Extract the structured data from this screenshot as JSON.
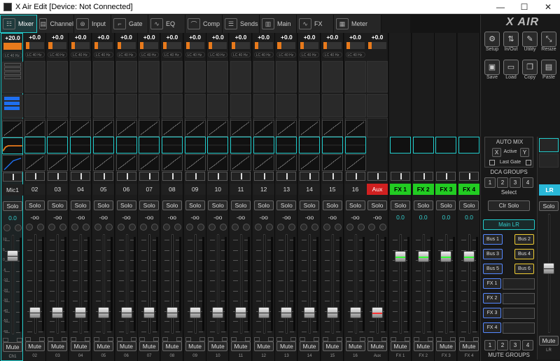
{
  "window": {
    "title": "X Air Edit [Device: Not Connected]",
    "min": "—",
    "max": "☐",
    "close": "✕"
  },
  "tabs": [
    {
      "label": "Mixer",
      "icon": "mixer-icon",
      "sym": "☷"
    },
    {
      "label": "Channel",
      "icon": "channel-icon",
      "sym": "▤"
    },
    {
      "label": "Input",
      "icon": "input-icon",
      "sym": "⊛"
    },
    {
      "label": "Gate",
      "icon": "gate-icon",
      "sym": "⌐"
    },
    {
      "label": "EQ",
      "icon": "eq-icon",
      "sym": "∿"
    },
    {
      "label": "Comp",
      "icon": "comp-icon",
      "sym": "⌒"
    },
    {
      "label": "Sends",
      "icon": "sends-icon",
      "sym": "☰"
    },
    {
      "label": "Main",
      "icon": "main-icon",
      "sym": "▥"
    },
    {
      "label": "FX",
      "icon": "fx-icon",
      "sym": "∿"
    },
    {
      "label": "Meter",
      "icon": "meter-icon",
      "sym": "▦"
    }
  ],
  "channels": [
    {
      "gain": "+20.0",
      "name": "Mic1",
      "pan": "0.0",
      "foot": "Ch1",
      "type": "mic"
    },
    {
      "gain": "+0.0",
      "name": "02",
      "pan": "-oo",
      "foot": "02",
      "type": "ch"
    },
    {
      "gain": "+0.0",
      "name": "03",
      "pan": "-oo",
      "foot": "03",
      "type": "ch"
    },
    {
      "gain": "+0.0",
      "name": "04",
      "pan": "-oo",
      "foot": "04",
      "type": "ch"
    },
    {
      "gain": "+0.0",
      "name": "05",
      "pan": "-oo",
      "foot": "05",
      "type": "ch"
    },
    {
      "gain": "+0.0",
      "name": "06",
      "pan": "-oo",
      "foot": "06",
      "type": "ch"
    },
    {
      "gain": "+0.0",
      "name": "07",
      "pan": "-oo",
      "foot": "07",
      "type": "ch"
    },
    {
      "gain": "+0.0",
      "name": "08",
      "pan": "-oo",
      "foot": "08",
      "type": "ch"
    },
    {
      "gain": "+0.0",
      "name": "09",
      "pan": "-oo",
      "foot": "09",
      "type": "ch"
    },
    {
      "gain": "+0.0",
      "name": "10",
      "pan": "-oo",
      "foot": "10",
      "type": "ch"
    },
    {
      "gain": "+0.0",
      "name": "11",
      "pan": "-oo",
      "foot": "11",
      "type": "ch"
    },
    {
      "gain": "+0.0",
      "name": "12",
      "pan": "-oo",
      "foot": "12",
      "type": "ch"
    },
    {
      "gain": "+0.0",
      "name": "13",
      "pan": "-oo",
      "foot": "13",
      "type": "ch"
    },
    {
      "gain": "+0.0",
      "name": "14",
      "pan": "-oo",
      "foot": "14",
      "type": "ch"
    },
    {
      "gain": "+0.0",
      "name": "15",
      "pan": "-oo",
      "foot": "15",
      "type": "ch"
    },
    {
      "gain": "+0.0",
      "name": "16",
      "pan": "-oo",
      "foot": "16",
      "type": "ch"
    },
    {
      "gain": "+0.0",
      "name": "Aux",
      "pan": "-oo",
      "foot": "Aux",
      "type": "aux"
    },
    {
      "gain": "",
      "name": "FX 1",
      "pan": "0.0",
      "foot": "FX 1",
      "type": "fx"
    },
    {
      "gain": "",
      "name": "FX 2",
      "pan": "0.0",
      "foot": "FX 2",
      "type": "fx"
    },
    {
      "gain": "",
      "name": "FX 3",
      "pan": "0.0",
      "foot": "FX 3",
      "type": "fx"
    },
    {
      "gain": "",
      "name": "FX 4",
      "pan": "0.0",
      "foot": "FX 4",
      "type": "fx"
    }
  ],
  "lowcut": "LC 40 Hz",
  "solo_label": "Solo",
  "mute_label": "Mute",
  "fader_scale": [
    "10",
    "5",
    "0",
    "-5",
    "-10",
    "-20",
    "-30",
    "-40",
    "-50",
    "-oo"
  ],
  "right": {
    "logo": "X AIR",
    "icons": [
      {
        "label": "Setup",
        "icon": "setup-icon",
        "sym": "⚙"
      },
      {
        "label": "In/Out",
        "icon": "inout-icon",
        "sym": "⇅"
      },
      {
        "label": "Utility",
        "icon": "utility-icon",
        "sym": "✎"
      },
      {
        "label": "Resize",
        "icon": "resize-icon",
        "sym": "⤡"
      },
      {
        "label": "Save",
        "icon": "save-icon",
        "sym": "▣"
      },
      {
        "label": "Load",
        "icon": "load-icon",
        "sym": "▭"
      },
      {
        "label": "Copy",
        "icon": "copy-icon",
        "sym": "❐"
      },
      {
        "label": "Paste",
        "icon": "paste-icon",
        "sym": "▤"
      }
    ],
    "automix": "AUTO MIX",
    "x": "X",
    "active": "Active",
    "y": "Y",
    "last_gate": "Last Gate",
    "dca": "DCA GROUPS",
    "dca_nums": [
      "1",
      "2",
      "3",
      "4"
    ],
    "select": "Select",
    "clr_solo": "Clr Solo",
    "main_lr": "Main LR",
    "buses": [
      "Bus 1",
      "Bus 2",
      "Bus 3",
      "Bus 4",
      "Bus 5",
      "Bus 6"
    ],
    "fx": [
      "FX 1",
      "FX 2",
      "FX 3",
      "FX 4"
    ],
    "mute_nums": [
      "1",
      "2",
      "3",
      "4"
    ],
    "mute_groups": "MUTE GROUPS"
  },
  "lr": {
    "name": "LR",
    "solo": "Solo",
    "mute": "Mute",
    "foot": "LR"
  }
}
